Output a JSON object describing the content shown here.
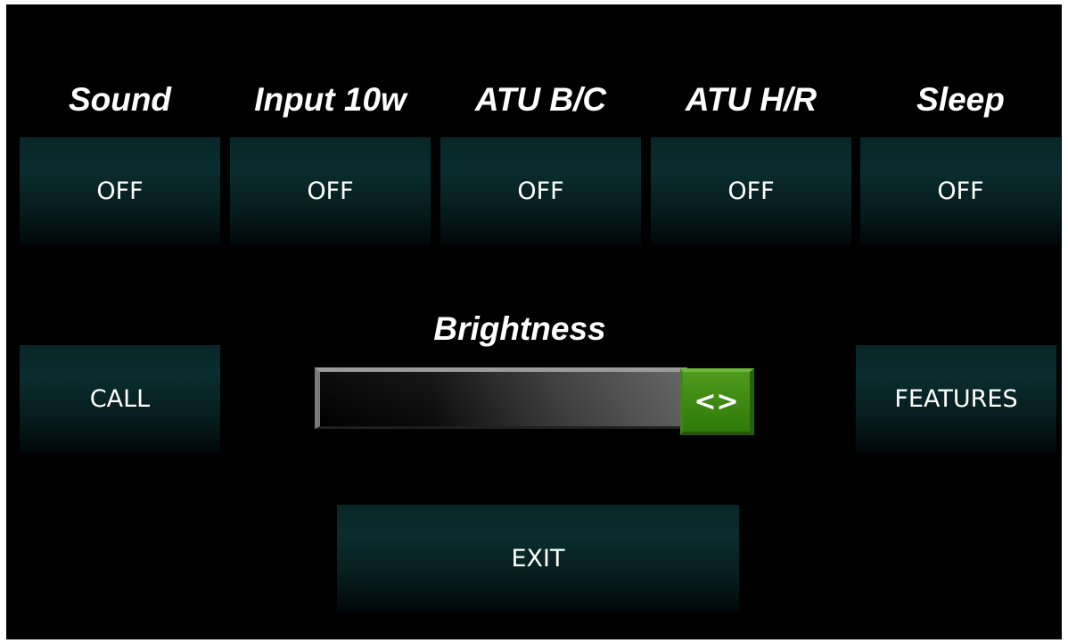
{
  "settings": [
    {
      "label": "Sound",
      "value": "OFF"
    },
    {
      "label": "Input 10w",
      "value": "OFF"
    },
    {
      "label": "ATU B/C",
      "value": "OFF"
    },
    {
      "label": "ATU H/R",
      "value": "OFF"
    },
    {
      "label": "Sleep",
      "value": "OFF"
    }
  ],
  "brightness": {
    "label": "Brightness",
    "thumb_label": "<>",
    "level_fraction": 1.0
  },
  "buttons": {
    "call": "CALL",
    "features": "FEATURES",
    "exit": "EXIT"
  },
  "colors": {
    "background": "#000000",
    "button": "#0a2d2f",
    "slider_thumb": "#3e8a12",
    "text": "#ffffff"
  }
}
